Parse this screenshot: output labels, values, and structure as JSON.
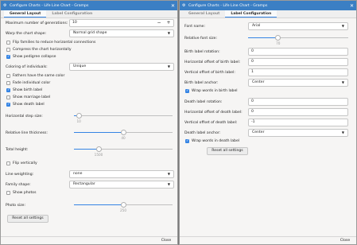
{
  "left": {
    "title": "Configure Charts - Life Line Chart - Gramps",
    "tabs": [
      {
        "label": "General Layout"
      },
      {
        "label": "Label Configuration"
      }
    ],
    "max_generations": {
      "label": "Maximum number of generations:",
      "value": "10",
      "minus": "−",
      "plus": "+"
    },
    "warp_shape": {
      "label": "Warp the chart shape:",
      "value": "Normal grid shape"
    },
    "flip_families": {
      "label": "Flip families to reduce horizontal connections",
      "checked": false
    },
    "compress": {
      "label": "Compress the chart horizontally",
      "checked": false
    },
    "pedigree_collapse": {
      "label": "Show pedigree collapse",
      "checked": true
    },
    "coloring": {
      "label": "Coloring of individuals:",
      "value": "Unique"
    },
    "fathers_same_color": {
      "label": "Fathers have the same color",
      "checked": false
    },
    "fade_color": {
      "label": "Fade individual color",
      "checked": false
    },
    "show_birth": {
      "label": "Show birth label",
      "checked": true
    },
    "show_marriage": {
      "label": "Show marriage label",
      "checked": false
    },
    "show_death": {
      "label": "Show death label",
      "checked": true
    },
    "h_step": {
      "label": "Horizontal step size:",
      "value": "10",
      "fraction": 0.05
    },
    "line_thickness": {
      "label": "Relative line thickness:",
      "value": "40",
      "fraction": 0.5
    },
    "total_height": {
      "label": "Total height:",
      "value": "1500",
      "fraction": 0.25
    },
    "flip_vertically": {
      "label": "Flip vertically",
      "checked": false
    },
    "line_weighting": {
      "label": "Line weighting:",
      "value": "none"
    },
    "family_shape": {
      "label": "Family shape:",
      "value": "Rectangular"
    },
    "show_photos": {
      "label": "Show photos",
      "checked": false
    },
    "photo_size": {
      "label": "Photo size:",
      "value": "250",
      "fraction": 0.5
    },
    "reset": "Reset all settings",
    "close": "Close"
  },
  "right": {
    "title": "Configure Charts - Life Line Chart - Gramps",
    "tabs": [
      {
        "label": "General Layout"
      },
      {
        "label": "Label Configuration"
      }
    ],
    "font_name": {
      "label": "Font name:",
      "value": "Arial"
    },
    "rel_font_size": {
      "label": "Relative font size:",
      "value": "70",
      "fraction": 0.3
    },
    "birth_rotation": {
      "label": "Birth label rotation:",
      "value": "0"
    },
    "birth_h_offset": {
      "label": "Horizontal offset of birth label:",
      "value": "0"
    },
    "birth_v_offset": {
      "label": "Vertical offset of birth label:",
      "value": "1"
    },
    "birth_anchor": {
      "label": "Birth label anchor:",
      "value": "Center"
    },
    "wrap_birth": {
      "label": "Wrap words in birth label",
      "checked": true
    },
    "death_rotation": {
      "label": "Death label rotation:",
      "value": "0"
    },
    "death_h_offset": {
      "label": "Horizontal offset of death label:",
      "value": "0"
    },
    "death_v_offset": {
      "label": "Vertical offset of death label:",
      "value": "-1"
    },
    "death_anchor": {
      "label": "Death label anchor:",
      "value": "Center"
    },
    "wrap_death": {
      "label": "Wrap words in death label",
      "checked": true
    },
    "reset": "Reset all settings",
    "close": "Close"
  },
  "icons": {
    "app": "gramps-app-icon",
    "close": "close-icon",
    "dropdown": "chevron-down-icon"
  },
  "colors": {
    "titlebar": "#3b7fc4",
    "accent": "#3584e4"
  }
}
